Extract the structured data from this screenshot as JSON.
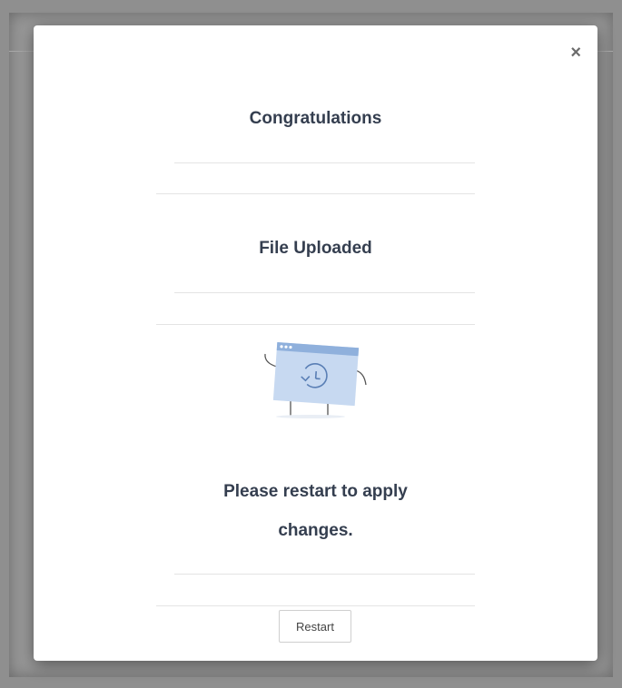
{
  "modal": {
    "close_label": "×",
    "title": "Congratulations",
    "subtitle": "File Uploaded",
    "message_line1": "Please restart to apply",
    "message_line2": "changes.",
    "illustration_icon": "clock-window-icon",
    "restart_label": "Restart"
  },
  "colors": {
    "heading_text": "#343e4f",
    "illustration_fill": "#c7d9f1",
    "illustration_header": "#8fb0dc",
    "backdrop": "#8f8f8f"
  }
}
